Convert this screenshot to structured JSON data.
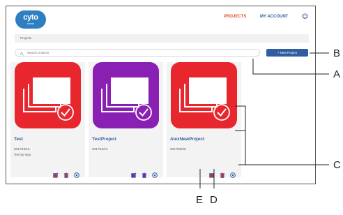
{
  "header": {
    "logo_brand": "cyto",
    "logo_sub": "smart",
    "nav": {
      "projects": "PROJECTS",
      "account": "MY ACCOUNT"
    }
  },
  "breadcrumb": "Projects",
  "search": {
    "placeholder": "Search projects"
  },
  "new_project_label": "+ New Project",
  "projects": [
    {
      "name": "Test",
      "date": "2017/10/19",
      "description": "Test by Ingo",
      "color": "#e8262e"
    },
    {
      "name": "TestProject",
      "date": "2017/10/12",
      "description": "",
      "color": "#8a1fb3"
    },
    {
      "name": "AlexNewProject",
      "date": "2017/09/29",
      "description": "",
      "color": "#e8262e"
    }
  ],
  "callouts": {
    "a": "A",
    "b": "B",
    "c": "C",
    "d": "D",
    "e": "E"
  },
  "colors": {
    "accent": "#e84c2f",
    "primary": "#2e5ea0",
    "logo": "#2e7ec2",
    "icon": "#2e5ea0"
  },
  "icons": {
    "edit": "edit-icon",
    "delete": "trash-icon",
    "open": "open-circle-icon",
    "done": "check-circle-icon"
  }
}
